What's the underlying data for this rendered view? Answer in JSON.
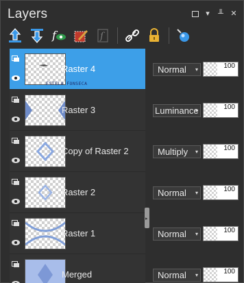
{
  "panel": {
    "title": "Layers"
  },
  "toolbar": {
    "buttons": [
      "new-raster-layer-icon",
      "new-layer-below-icon",
      "layer-effects-icon",
      "edit-selection-icon",
      "mask-icon",
      "link-icon",
      "lock-icon",
      "properties-icon"
    ]
  },
  "layers": [
    {
      "name": "Raster 4",
      "selected": true,
      "blend": "Normal",
      "opacity": "100",
      "watermark": "ESTELA FONSECA"
    },
    {
      "name": "Raster 3",
      "selected": false,
      "blend": "Luminance",
      "opacity": "100"
    },
    {
      "name": "Copy of Raster 2",
      "selected": false,
      "blend": "Multiply",
      "opacity": "100"
    },
    {
      "name": "Raster 2",
      "selected": false,
      "blend": "Normal",
      "opacity": "100"
    },
    {
      "name": "Raster 1",
      "selected": false,
      "blend": "Normal",
      "opacity": "100"
    },
    {
      "name": "Merged",
      "selected": false,
      "blend": "Normal",
      "opacity": "100"
    }
  ],
  "colors": {
    "selection": "#3d9fe8",
    "panel_bg": "#2e2e2e"
  }
}
